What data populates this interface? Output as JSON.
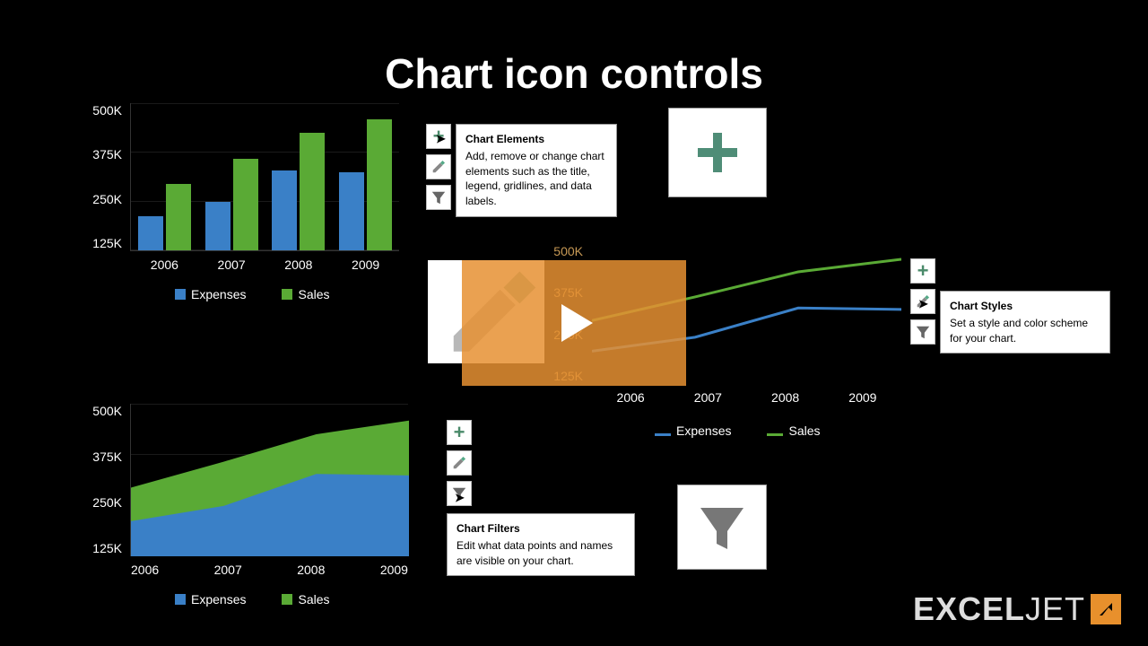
{
  "title": "Chart icon controls",
  "chart_data": [
    {
      "id": "bar",
      "type": "bar",
      "categories": [
        "2006",
        "2007",
        "2008",
        "2009"
      ],
      "series": [
        {
          "name": "Expenses",
          "values": [
            115000,
            165000,
            270000,
            265000
          ],
          "color": "#3a80c7"
        },
        {
          "name": "Sales",
          "values": [
            225000,
            310000,
            400000,
            445000
          ],
          "color": "#5aaa35"
        }
      ],
      "ylim": [
        0,
        500000
      ],
      "yticks": [
        "125K",
        "250K",
        "375K",
        "500K"
      ]
    },
    {
      "id": "line",
      "type": "line",
      "categories": [
        "2006",
        "2007",
        "2008",
        "2009"
      ],
      "series": [
        {
          "name": "Expenses",
          "values": [
            115000,
            165000,
            270000,
            265000
          ],
          "color": "#3a80c7"
        },
        {
          "name": "Sales",
          "values": [
            225000,
            310000,
            400000,
            445000
          ],
          "color": "#5aaa35"
        }
      ],
      "ylim": [
        0,
        500000
      ],
      "yticks": [
        "125K",
        "250K",
        "375K",
        "500K"
      ]
    },
    {
      "id": "area",
      "type": "area",
      "categories": [
        "2006",
        "2007",
        "2008",
        "2009"
      ],
      "series": [
        {
          "name": "Expenses",
          "values": [
            115000,
            165000,
            270000,
            265000
          ],
          "color": "#3a80c7"
        },
        {
          "name": "Sales",
          "values": [
            225000,
            310000,
            400000,
            445000
          ],
          "color": "#5aaa35"
        }
      ],
      "ylim": [
        0,
        500000
      ],
      "yticks": [
        "125K",
        "250K",
        "375K",
        "500K"
      ]
    }
  ],
  "tooltips": {
    "elements": {
      "title": "Chart Elements",
      "body": "Add, remove or change chart elements such as the title, legend, gridlines, and data labels."
    },
    "styles": {
      "title": "Chart Styles",
      "body": "Set a style and color scheme for your chart."
    },
    "filters": {
      "title": "Chart Filters",
      "body": "Edit what data points and names are visible on your chart."
    }
  },
  "legend": {
    "expenses": "Expenses",
    "sales": "Sales"
  },
  "logo": {
    "text_bold": "EXCEL",
    "text_light": "JET"
  }
}
